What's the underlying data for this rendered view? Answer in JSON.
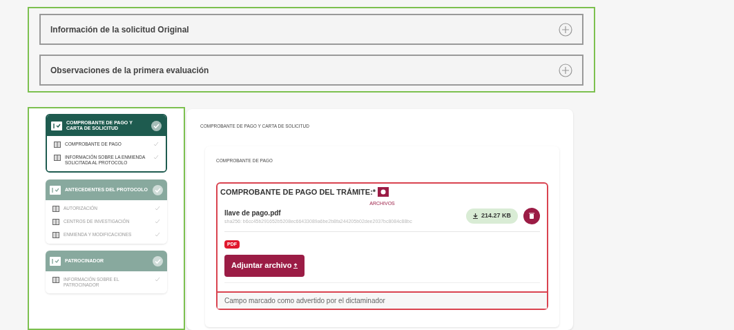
{
  "accordions": [
    {
      "title": "Información de la solicitud Original",
      "expanded": false
    },
    {
      "title": "Observaciones de la primera evaluación",
      "expanded": false
    }
  ],
  "sidebar": {
    "sections": [
      {
        "title": "COMPROBANTE DE PAGO Y CARTA DE SOLICITUD",
        "selected": true,
        "completed": true,
        "items": [
          {
            "label": "COMPROBANTE DE PAGO",
            "completed": true
          },
          {
            "label": "INFORMACIÓN SOBRE LA ENMIENDA SOLICITADA AL PROTOCOLO",
            "completed": true
          }
        ]
      },
      {
        "title": "ANTECEDENTES DEL PROTOCOLO",
        "selected": false,
        "completed": true,
        "items": [
          {
            "label": "AUTORIZACIÓN",
            "completed": true
          },
          {
            "label": "CENTROS DE INVESTIGACIÓN",
            "completed": true
          },
          {
            "label": "ENMIENDA Y MODIFICACIONES",
            "completed": true
          }
        ]
      },
      {
        "title": "PATROCINADOR",
        "selected": false,
        "completed": true,
        "items": [
          {
            "label": "INFORMACIÓN SOBRE EL PATROCINADOR",
            "completed": true
          }
        ]
      }
    ]
  },
  "main": {
    "title": "COMPROBANTE DE PAGO Y CARTA DE SOLICITUD",
    "card_title": "COMPROBANTE DE PAGO",
    "field": {
      "label": "COMPROBANTE DE PAGO DEL TRÁMITE:*",
      "flagged": true,
      "files_heading": "ARCHIVOS",
      "files": [
        {
          "name": "llave de pago.pdf",
          "hash": "sha256: b6cc45b291652b5208ec66433089a6be2b8fa244205b02dee2037bc8084c88bc",
          "size": "214.27 KB"
        }
      ],
      "format_badge": "PDF",
      "attach_button": "Adjuntar archivo",
      "note": "Campo marcado como advertido por el dictaminador"
    }
  }
}
